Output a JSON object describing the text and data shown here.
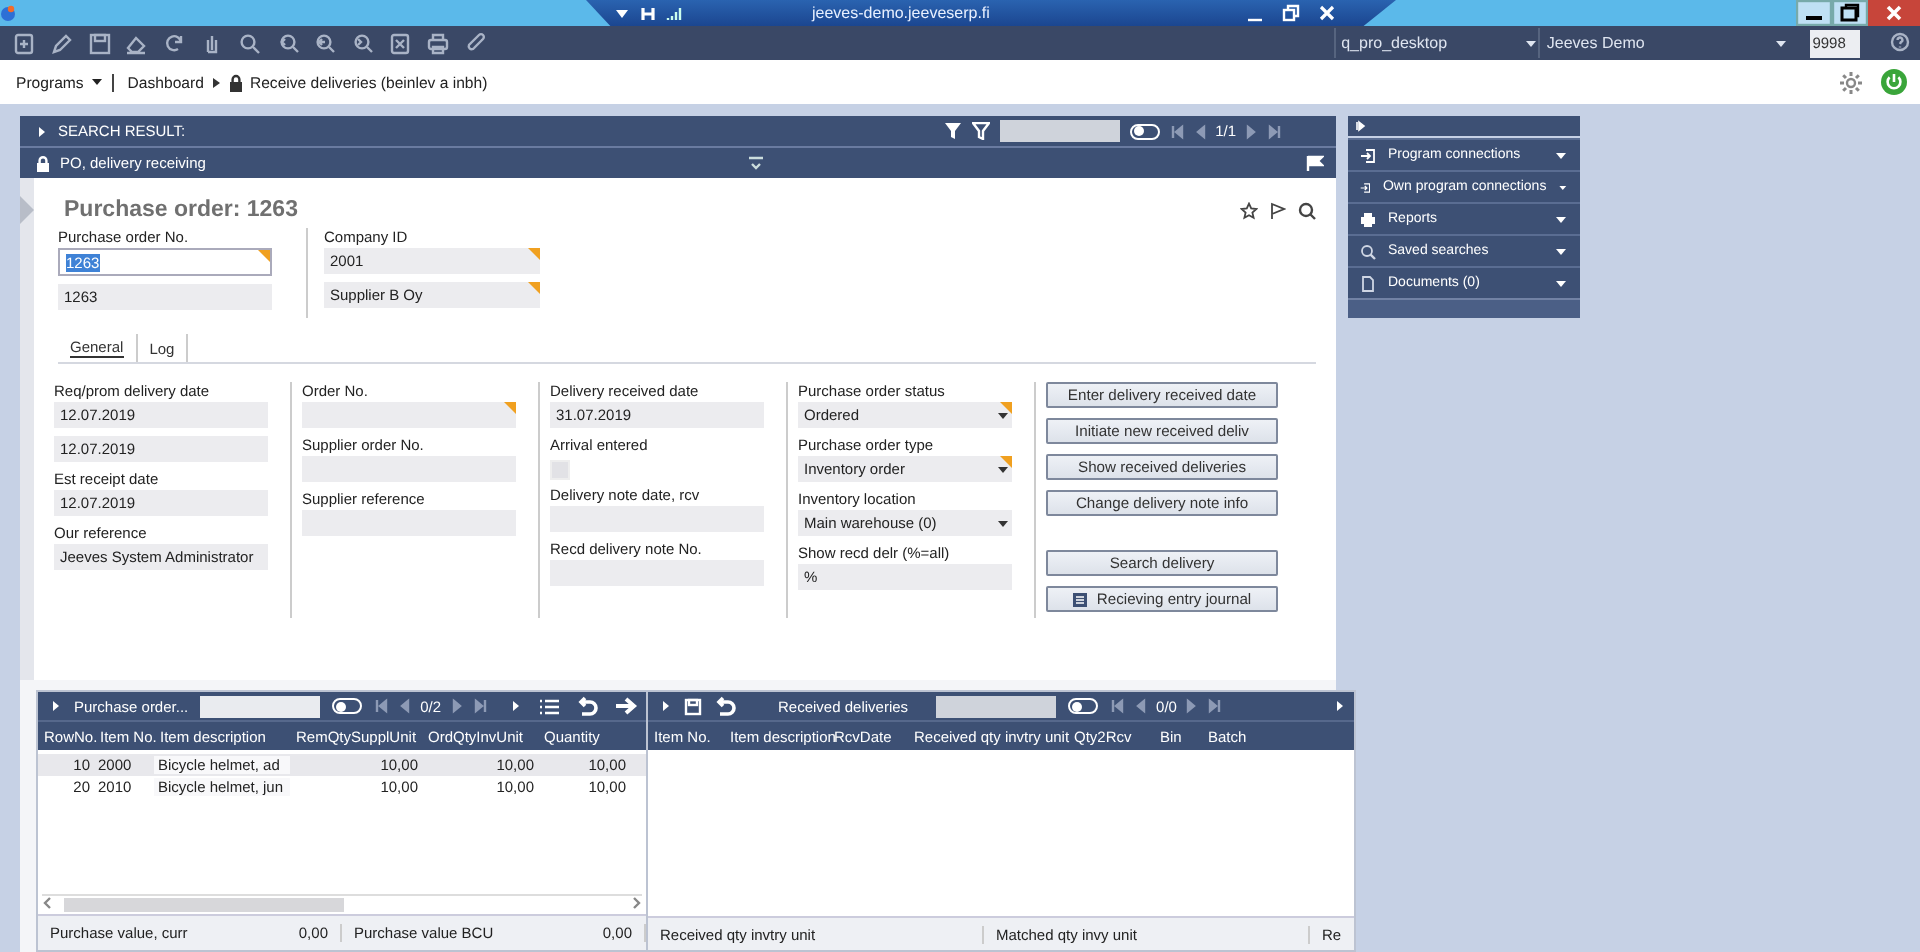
{
  "window": {
    "title": "jeeves-demo.jeeveserp.fi"
  },
  "toolbar": {
    "environment": "q_pro_desktop",
    "database": "Jeeves Demo",
    "user": "9998"
  },
  "breadcrumb": [
    {
      "label": "Programs",
      "kind": "menu"
    },
    {
      "label": "Dashboard",
      "kind": "link"
    },
    {
      "label": "Receive deliveries (beinlev a inbh)",
      "kind": "locked"
    }
  ],
  "search_result": {
    "title": "SEARCH RESULT:",
    "toggle_on": false,
    "pager": "1/1"
  },
  "form_bar": {
    "title": "PO, delivery receiving"
  },
  "form": {
    "title": "Purchase order: 1263",
    "header": [
      [
        {
          "label": "Purchase order No.",
          "kind": "text",
          "value": "1263",
          "flagged": true,
          "text_selected": true
        },
        {
          "kind": "text",
          "value": "1263",
          "flagged": false
        }
      ],
      [
        {
          "label": "Company ID",
          "kind": "text",
          "value": "2001",
          "flagged": true
        },
        {
          "kind": "text",
          "value": "Supplier B Oy",
          "flagged": true
        }
      ]
    ],
    "tabs": [
      {
        "label": "General",
        "selected": true
      },
      {
        "label": "Log",
        "selected": false
      }
    ],
    "columns": [
      [
        {
          "label": "Req/prom delivery date",
          "kind": "text",
          "value": "12.07.2019",
          "flagged": false
        },
        {
          "kind": "text",
          "value": "12.07.2019",
          "flagged": false
        },
        {
          "label": "Est receipt date",
          "kind": "text",
          "value": "12.07.2019",
          "flagged": false
        },
        {
          "label": "Our reference",
          "kind": "text",
          "value": "Jeeves System Administrator",
          "flagged": false
        }
      ],
      [
        {
          "label": "Order No.",
          "kind": "text",
          "flagged": true
        },
        {
          "label": "Supplier order No.",
          "kind": "text",
          "flagged": false
        },
        {
          "label": "Supplier reference",
          "kind": "text",
          "flagged": false
        }
      ],
      [
        {
          "label": "Delivery received date",
          "kind": "text",
          "value": "31.07.2019",
          "flagged": false
        },
        {
          "label": "Arrival entered",
          "kind": "checkbox",
          "checked": false
        },
        {
          "label": "Delivery note date, rcv",
          "kind": "text",
          "flagged": false
        },
        {
          "label": "Recd delivery note No.",
          "kind": "text",
          "flagged": false
        }
      ],
      [
        {
          "label": "Purchase order status",
          "kind": "dropdown",
          "value": "Ordered",
          "flagged": true
        },
        {
          "label": "Purchase order type",
          "kind": "dropdown",
          "value": "Inventory order",
          "flagged": true
        },
        {
          "label": "Inventory location",
          "kind": "dropdown",
          "value": "Main warehouse (0)",
          "flagged": false
        },
        {
          "label": "Show recd delr (%=all)",
          "kind": "text",
          "value": "%",
          "flagged": false
        }
      ]
    ],
    "buttons": [
      {
        "label": "Enter delivery received date",
        "kind": "plain",
        "separated": false
      },
      {
        "label": "Initiate new received deliv",
        "kind": "plain",
        "separated": false
      },
      {
        "label": "Show received deliveries",
        "kind": "plain",
        "separated": false
      },
      {
        "label": "Change delivery note info",
        "kind": "plain",
        "separated": false
      },
      {
        "label": "Search delivery",
        "kind": "plain",
        "separated": true
      },
      {
        "label": "Recieving entry journal",
        "kind": "journal",
        "separated": false
      }
    ]
  },
  "grids": [
    {
      "kind": "order_lines",
      "title": "Purchase order...",
      "toggle_on": false,
      "pager": "0/2",
      "columns": [
        "RowNo.",
        "Item No.",
        "Item description",
        "RemQtySupplUnit",
        "OrdQtyInvUnit",
        "Quantity"
      ],
      "rows": [
        {
          "cells": [
            "10",
            "2000",
            "Bicycle helmet, ad",
            "10,00",
            "10,00",
            "10,00"
          ],
          "selected": true
        },
        {
          "cells": [
            "20",
            "2010",
            "Bicycle helmet, jun",
            "10,00",
            "10,00",
            "10,00"
          ],
          "selected": false
        }
      ],
      "totals": [
        {
          "label": "Purchase value, curr",
          "value": "0,00"
        },
        {
          "label": "Purchase value BCU",
          "value": "0,00"
        }
      ]
    },
    {
      "kind": "received",
      "title": "Received deliveries",
      "toggle_on": false,
      "pager": "0/0",
      "columns": [
        "Item No.",
        "Item description",
        "RcvDate",
        "Received qty invtry unit",
        "Qty2Rcv",
        "Bin",
        "Batch"
      ],
      "totals": [
        {
          "label": "Received qty invtry unit"
        },
        {
          "label": "Matched qty invy unit"
        },
        {
          "label": "Re"
        }
      ]
    }
  ],
  "sidebar": {
    "items": [
      {
        "label": "Program connections",
        "kind": "enter"
      },
      {
        "label": "Own program connections",
        "kind": "enter"
      },
      {
        "label": "Reports",
        "kind": "print"
      },
      {
        "label": "Saved searches",
        "kind": "search"
      },
      {
        "label": "Documents (0)",
        "kind": "document"
      }
    ]
  }
}
